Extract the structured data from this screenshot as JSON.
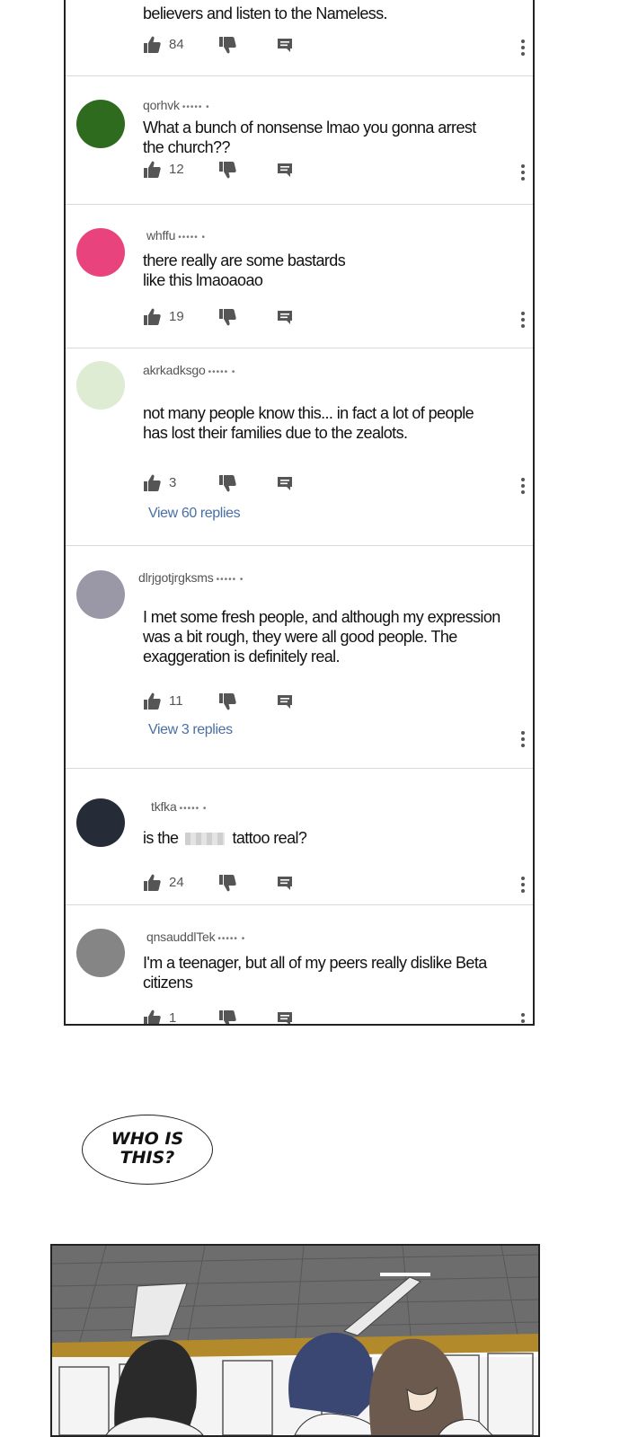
{
  "comments": [
    {
      "username": "",
      "stars": "",
      "text": "believers and listen to  the Nameless.",
      "likes": "84",
      "view_replies": "",
      "avatar_color": ""
    },
    {
      "username": "qorhvk",
      "stars": "•••••  •",
      "text": "What a bunch of nonsense lmao you gonna arrest the church??",
      "likes": "12",
      "view_replies": "",
      "avatar_color": "#2f6b1f"
    },
    {
      "username": "whffu",
      "stars": "•••••  •",
      "text": "there really are some bastards\nlike this lmaoaoao",
      "likes": "19",
      "view_replies": "",
      "avatar_color": "#e8437c"
    },
    {
      "username": "akrkadksgo",
      "stars": "•••••  •",
      "text": "not many people know this... in fact a lot of people has lost their families due to the zealots.",
      "likes": "3",
      "view_replies": "View 60 replies",
      "avatar_color": "#ddecd3"
    },
    {
      "username": "dlrjgotjrgksms",
      "stars": "•••••  •",
      "text": "I met some fresh people, and although my expression was a bit rough, they were all good people. The exaggeration is definitely real.",
      "likes": "11",
      "view_replies": "View 3 replies",
      "avatar_color": "#9a98a6"
    },
    {
      "username": "tkfka",
      "stars": "•••••    •",
      "text_before": "is the",
      "text_after": "tattoo real?",
      "likes": "24",
      "view_replies": "",
      "avatar_color": "#262b38"
    },
    {
      "username": "qnsauddlTek",
      "stars": "•••••  •",
      "text": "I'm a teenager, but all of my peers really dislike Beta citizens",
      "likes": "1",
      "view_replies": "",
      "avatar_color": "#858585"
    }
  ],
  "bubble": {
    "text": "WHO IS\nTHIS?"
  },
  "icons": {
    "like": "thumbs-up-icon",
    "dislike": "thumbs-down-icon",
    "reply": "reply-icon",
    "more": "more-vert-icon"
  }
}
